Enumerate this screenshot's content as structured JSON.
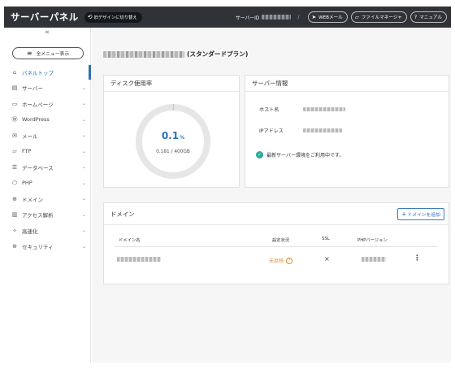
{
  "header": {
    "brand": "サーバーパネル",
    "switch_design": "旧デザインに切り替え",
    "server_id_label": "サーバーID",
    "slash": "/",
    "webmail": "WEBメール",
    "file_manager": "ファイルマネージャ",
    "manual": "マニュアル"
  },
  "sidebar": {
    "collapse_icon": "«",
    "all_menu": "全メニュー表示",
    "items": [
      {
        "label": "パネルトップ",
        "icon": "home-icon",
        "glyph": "⌂"
      },
      {
        "label": "サーバー",
        "icon": "server-icon",
        "glyph": "▤"
      },
      {
        "label": "ホームページ",
        "icon": "monitor-icon",
        "glyph": "▭"
      },
      {
        "label": "WordPress",
        "icon": "wordpress-icon",
        "glyph": "Ⓦ"
      },
      {
        "label": "メール",
        "icon": "mail-icon",
        "glyph": "✉"
      },
      {
        "label": "FTP",
        "icon": "ftp-icon",
        "glyph": "▱"
      },
      {
        "label": "データベース",
        "icon": "database-icon",
        "glyph": "☰"
      },
      {
        "label": "PHP",
        "icon": "php-icon",
        "glyph": "⬡"
      },
      {
        "label": "ドメイン",
        "icon": "globe-icon",
        "glyph": "⊕"
      },
      {
        "label": "アクセス解析",
        "icon": "chart-icon",
        "glyph": "▥"
      },
      {
        "label": "高速化",
        "icon": "speed-icon",
        "glyph": "✧"
      },
      {
        "label": "セキュリティ",
        "icon": "shield-icon",
        "glyph": "⊛"
      }
    ]
  },
  "main": {
    "plan_suffix": "(スタンダードプラン)",
    "disk": {
      "title": "ディスク使用率",
      "percent": "0.1",
      "percent_unit": "%",
      "usage": "0.181 / 400GB",
      "fill_fraction": 0.001,
      "ring_color": "#e6e6e6",
      "fill_color": "#2f6fb6"
    },
    "server_info": {
      "title": "サーバー情報",
      "host_label": "ホスト名",
      "ip_label": "IPアドレス",
      "notice": "最新サーバー環境をご利用中です。"
    },
    "domains": {
      "title": "ドメイン",
      "add_button": "ドメインを追加",
      "columns": [
        "ドメイン名",
        "設定状況",
        "SSL",
        "PHPバージョン"
      ],
      "row": {
        "status": "未反映",
        "ssl": "×",
        "menu": "⋮"
      }
    }
  }
}
